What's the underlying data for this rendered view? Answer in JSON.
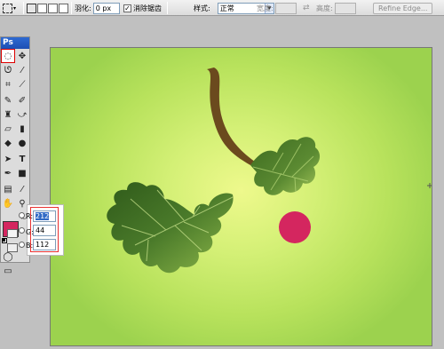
{
  "options_bar": {
    "feather_label": "羽化:",
    "feather_value": "0 px",
    "antialias_label": "消除锯齿",
    "antialias_checked": true,
    "style_label": "样式:",
    "style_value": "正常",
    "width_label": "宽度:",
    "height_label": "高度:",
    "refine_edge_label": "Refine Edge..."
  },
  "toolbox": {
    "logo": "Ps"
  },
  "colors": {
    "foreground": "#d4265f",
    "accent": "#316ac5"
  },
  "color_panel": {
    "r_label": "R:",
    "g_label": "G:",
    "b_label": "B:",
    "r_value": "212",
    "g_value": "44",
    "b_value": "112"
  }
}
